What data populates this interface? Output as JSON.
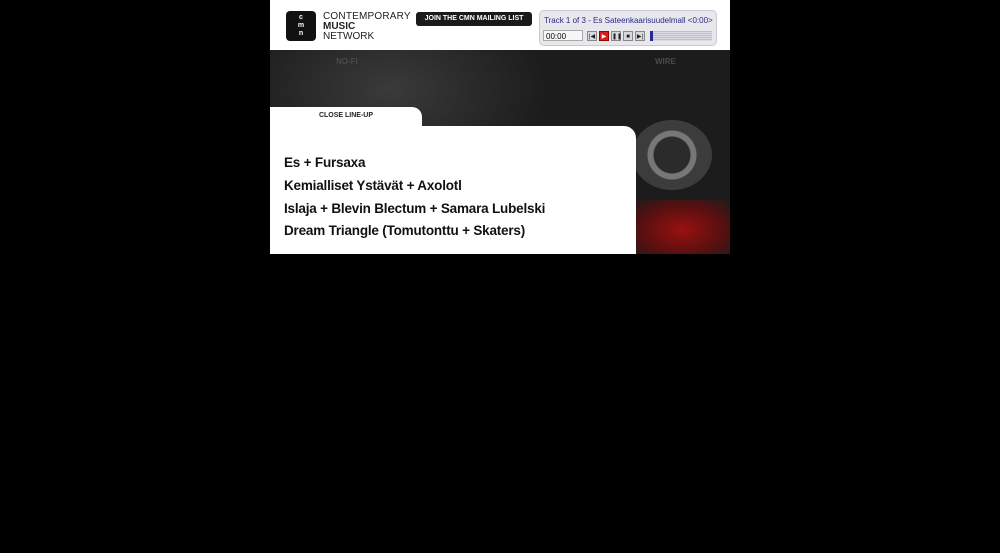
{
  "brand": {
    "line1": "CONTEMPORARY",
    "line2": "MUSIC",
    "line3": "NETWORK",
    "logo_glyph": "cmn"
  },
  "header": {
    "join_label": "JOIN THE CMN MAILING LIST"
  },
  "player": {
    "track_title": "Track 1 of 3 - Es Sateenkaarisuudelmall <0:00>",
    "time": "00:00",
    "buttons": [
      "prev",
      "play",
      "pause",
      "stop",
      "next"
    ],
    "volume_fraction": 0.05
  },
  "sponsors": [
    "NO-FI",
    "WIRE"
  ],
  "lineup": {
    "close_label": "CLOSE LINE-UP",
    "acts": [
      "Es + Fursaxa",
      "Kemialliset Ystävät + Axolotl",
      "Islaja + Blevin Blectum + Samara Lubelski",
      "Dream Triangle (Tomutonttu + Skaters)"
    ]
  },
  "colors": {
    "accent_blue": "#2a2a8c",
    "play_red": "#d42020"
  }
}
